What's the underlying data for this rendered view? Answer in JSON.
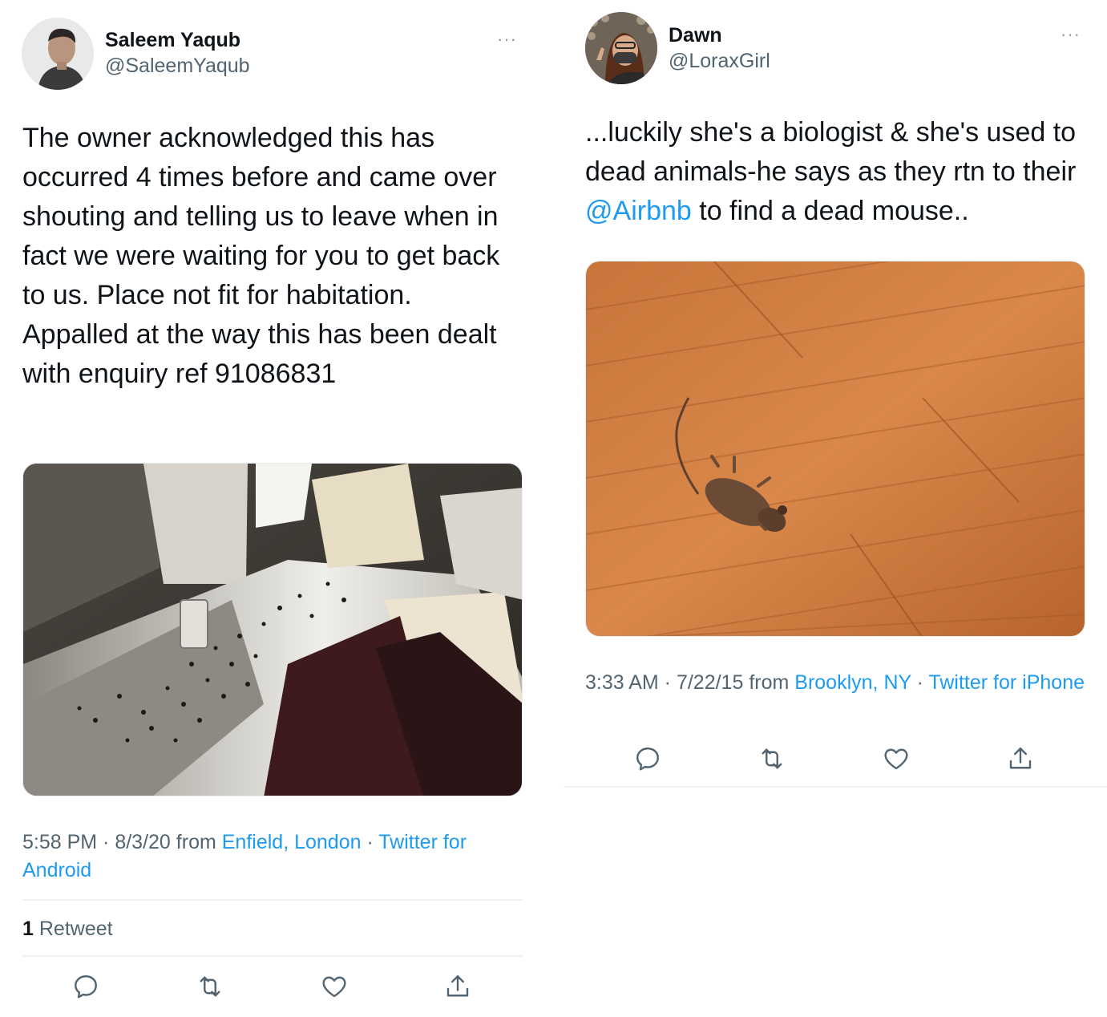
{
  "left_tweet": {
    "name": "Saleem Yaqub",
    "handle": "@SaleemYaqub",
    "more_glyph": "···",
    "text": "The owner acknowledged this has occurred 4 times before and came over shouting and telling us to leave when in fact we were waiting for you to get back to us. Place not fit for habitation. Appalled at the way this has been dealt with enquiry ref 91086831",
    "time": "5:58 PM",
    "date": "8/3/20",
    "from": "from",
    "location": "Enfield, London",
    "client": "Twitter for Android",
    "retweet_count": "1",
    "retweet_label": "Retweet",
    "icons": [
      "reply-icon",
      "retweet-icon",
      "like-icon",
      "share-icon"
    ]
  },
  "right_tweet": {
    "name": "Dawn",
    "handle": "@LoraxGirl",
    "more_glyph": "···",
    "text_before": "...luckily she's a biologist & she's used to dead animals-he says as they rtn to their ",
    "mention": "@Airbnb",
    "text_after": " to find a dead mouse..",
    "time": "3:33 AM",
    "date": "7/22/15",
    "from": "from",
    "location": "Brooklyn, NY",
    "client": "Twitter for iPhone",
    "icons": [
      "reply-icon",
      "retweet-icon",
      "like-icon",
      "share-icon"
    ]
  },
  "colors": {
    "link": "#1d9bf0",
    "secondary_text": "#536471",
    "primary_text": "#0f1419"
  }
}
